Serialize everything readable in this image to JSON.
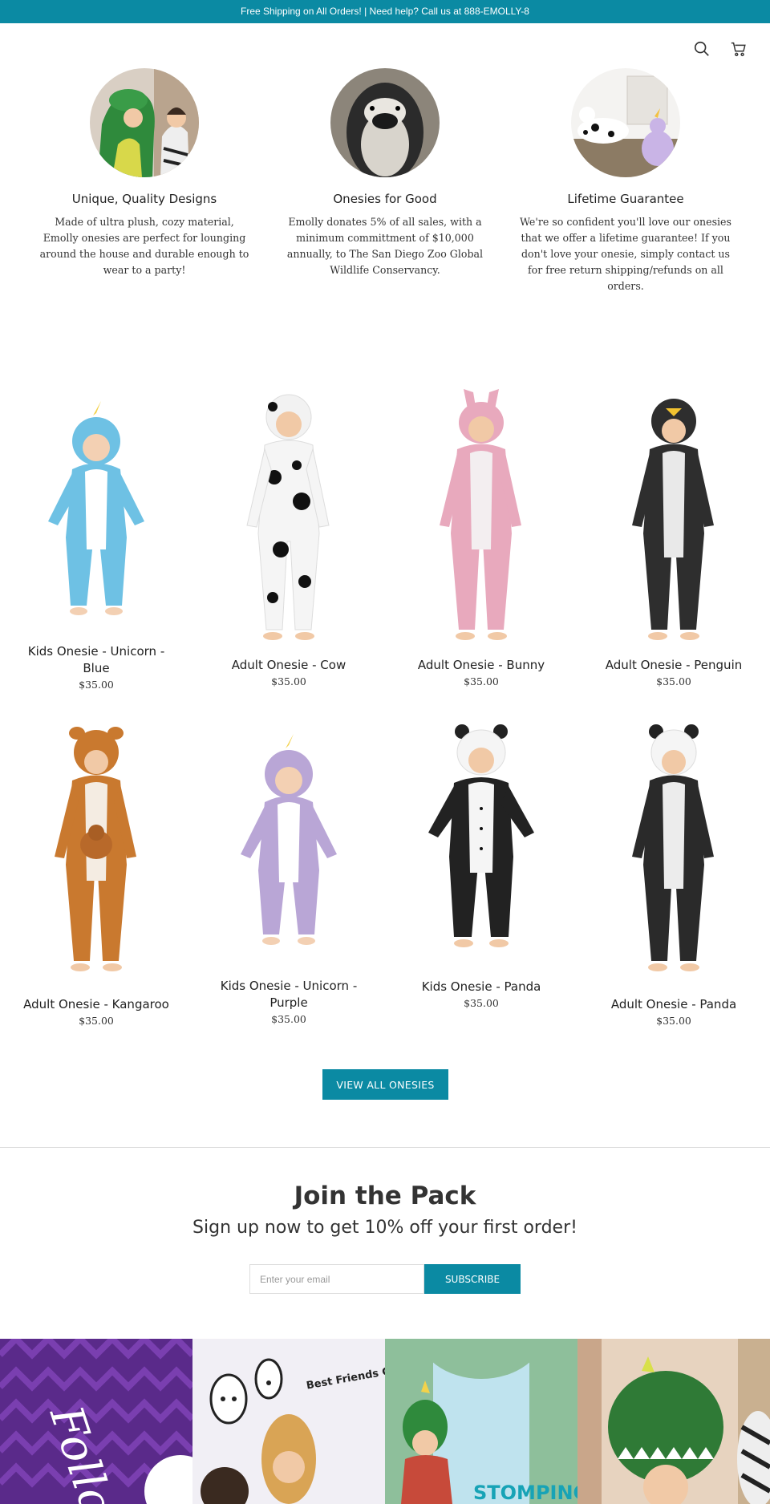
{
  "topbar": {
    "text": "Free Shipping on All Orders! | Need help? Call us at 888-EMOLLY-8"
  },
  "header": {
    "search_icon": "search-icon",
    "cart_icon": "cart-icon"
  },
  "features": [
    {
      "title": "Unique, Quality Designs",
      "text": "Made of ultra plush, cozy material, Emolly onesies are perfect for lounging around the house and durable enough to wear to a party!"
    },
    {
      "title": "Onesies for Good",
      "text": "Emolly donates 5% of all sales, with a minimum committment of $10,000 annually, to The San Diego Zoo Global Wildlife Conservancy."
    },
    {
      "title": "Lifetime Guarantee",
      "text": "We're so confident you'll love our onesies that we offer a lifetime guarantee! If you don't love your onesie, simply contact us for free return shipping/refunds on all orders."
    }
  ],
  "products": [
    {
      "title": "Kids Onesie - Unicorn - Blue",
      "price": "$35.00",
      "color": "#6ec1e4"
    },
    {
      "title": "Adult Onesie - Cow",
      "price": "$35.00",
      "color": "#f2f2f2"
    },
    {
      "title": "Adult Onesie - Bunny",
      "price": "$35.00",
      "color": "#e8a9bd"
    },
    {
      "title": "Adult Onesie - Penguin",
      "price": "$35.00",
      "color": "#2e2e2e"
    },
    {
      "title": "Adult Onesie - Kangaroo",
      "price": "$35.00",
      "color": "#c9792f"
    },
    {
      "title": "Kids Onesie - Unicorn - Purple",
      "price": "$35.00",
      "color": "#b9a6d6"
    },
    {
      "title": "Kids Onesie - Panda",
      "price": "$35.00",
      "color": "#222222"
    },
    {
      "title": "Adult Onesie - Panda",
      "price": "$35.00",
      "color": "#2a2a2a"
    }
  ],
  "view_all": {
    "label": "VIEW ALL ONESIES"
  },
  "newsletter": {
    "title": "Join the Pack",
    "subtitle": "Sign up now to get 10% off your first order!",
    "placeholder": "Enter your email",
    "button": "SUBSCRIBE"
  },
  "gallery": {
    "follow_text": "Follow",
    "bubble_text": "Best Friends Goals. Lounge all day long!",
    "stomping_text": "STOMPING"
  }
}
